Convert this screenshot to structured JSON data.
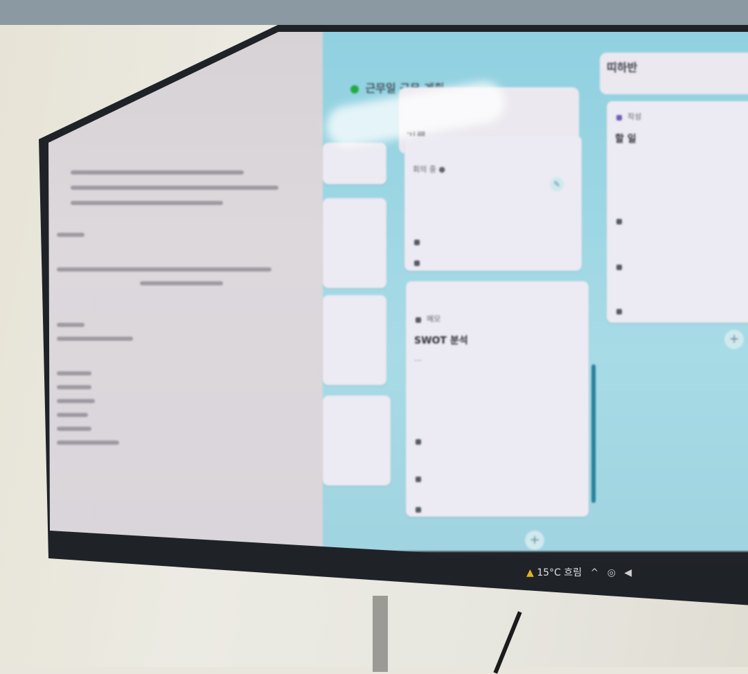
{
  "photo": {
    "subject": "photo of a wall-mounted monitor showing a document and a kanban board"
  },
  "kanban": {
    "board_title": "근무일 근무 계획",
    "columns": [
      {
        "header": "기록"
      },
      {
        "header": "띠하반"
      }
    ],
    "cards": [
      {
        "title": "",
        "text": "회의 중 ● ",
        "meta": [
          "",
          ""
        ]
      },
      {
        "label": "메모",
        "title": "SWOT 분석",
        "text": "...",
        "meta": [
          "",
          ""
        ]
      },
      {
        "label": "작성",
        "title": "할 일",
        "text": "",
        "meta": [
          "",
          ""
        ]
      }
    ]
  },
  "tray": {
    "weather": "15°C 흐림"
  },
  "colors": {
    "kanban_bg": "#a7dbe6",
    "card_bg": "#eceaf2",
    "taskbar": "#222329",
    "accent_dot": "#22aa44"
  }
}
